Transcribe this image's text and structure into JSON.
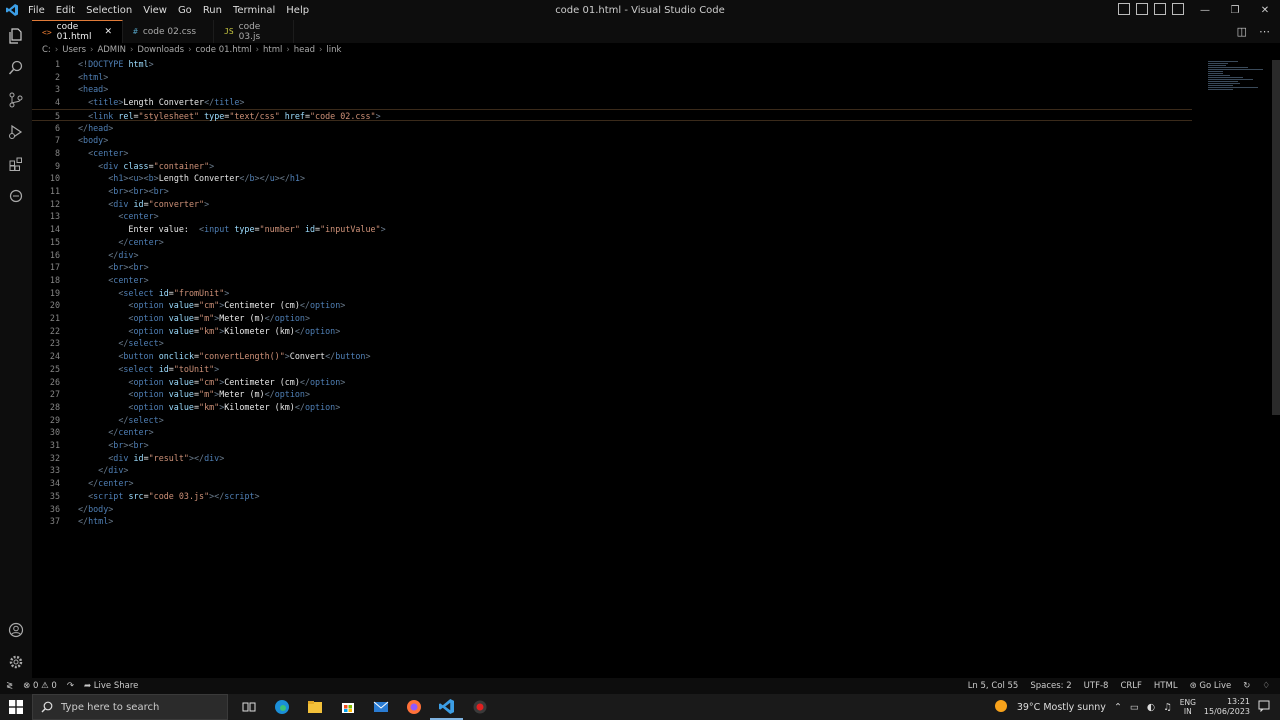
{
  "window": {
    "title": "code 01.html - Visual Studio Code",
    "menu": [
      "File",
      "Edit",
      "Selection",
      "View",
      "Go",
      "Run",
      "Terminal",
      "Help"
    ]
  },
  "tabs": [
    {
      "label": "code 01.html",
      "icon": "<>",
      "icon_color": "#e37933",
      "active": true
    },
    {
      "label": "code 02.css",
      "icon": "#",
      "icon_color": "#519aba",
      "active": false
    },
    {
      "label": "code 03.js",
      "icon": "JS",
      "icon_color": "#cbcb41",
      "active": false
    }
  ],
  "breadcrumb": [
    "C:",
    "Users",
    "ADMIN",
    "Downloads",
    "code 01.html",
    "html",
    "head",
    "link"
  ],
  "code_lines": [
    [
      [
        "t",
        "<!"
      ],
      [
        "tn",
        "DOCTYPE "
      ],
      [
        "an",
        "html"
      ],
      [
        "t",
        ">"
      ]
    ],
    [
      [
        "t",
        "<"
      ],
      [
        "tn",
        "html"
      ],
      [
        "t",
        ">"
      ]
    ],
    [
      [
        "t",
        "<"
      ],
      [
        "tn",
        "head"
      ],
      [
        "t",
        ">"
      ]
    ],
    [
      [
        "t",
        "  <"
      ],
      [
        "tn",
        "title"
      ],
      [
        "t",
        ">"
      ],
      [
        "tx",
        "Length Converter"
      ],
      [
        "t",
        "</"
      ],
      [
        "tn",
        "title"
      ],
      [
        "t",
        ">"
      ]
    ],
    [
      [
        "t",
        "  <"
      ],
      [
        "tn",
        "link "
      ],
      [
        "an",
        "rel"
      ],
      [
        "tx",
        "="
      ],
      [
        "av",
        "\"stylesheet\" "
      ],
      [
        "an",
        "type"
      ],
      [
        "tx",
        "="
      ],
      [
        "av",
        "\"text/css\" "
      ],
      [
        "an",
        "href"
      ],
      [
        "tx",
        "="
      ],
      [
        "av",
        "\"code 02.css\""
      ],
      [
        "t",
        ">"
      ]
    ],
    [
      [
        "t",
        "</"
      ],
      [
        "tn",
        "head"
      ],
      [
        "t",
        ">"
      ]
    ],
    [
      [
        "t",
        "<"
      ],
      [
        "tn",
        "body"
      ],
      [
        "t",
        ">"
      ]
    ],
    [
      [
        "t",
        "  <"
      ],
      [
        "tn",
        "center"
      ],
      [
        "t",
        ">"
      ]
    ],
    [
      [
        "t",
        "    <"
      ],
      [
        "tn",
        "div "
      ],
      [
        "an",
        "class"
      ],
      [
        "tx",
        "="
      ],
      [
        "av",
        "\"container\""
      ],
      [
        "t",
        ">"
      ]
    ],
    [
      [
        "t",
        "      <"
      ],
      [
        "tn",
        "h1"
      ],
      [
        "t",
        "><"
      ],
      [
        "tn",
        "u"
      ],
      [
        "t",
        "><"
      ],
      [
        "tn",
        "b"
      ],
      [
        "t",
        ">"
      ],
      [
        "tx",
        "Length Converter"
      ],
      [
        "t",
        "</"
      ],
      [
        "tn",
        "b"
      ],
      [
        "t",
        "></"
      ],
      [
        "tn",
        "u"
      ],
      [
        "t",
        "></"
      ],
      [
        "tn",
        "h1"
      ],
      [
        "t",
        ">"
      ]
    ],
    [
      [
        "t",
        "      <"
      ],
      [
        "tn",
        "br"
      ],
      [
        "t",
        "><"
      ],
      [
        "tn",
        "br"
      ],
      [
        "t",
        "><"
      ],
      [
        "tn",
        "br"
      ],
      [
        "t",
        ">"
      ]
    ],
    [
      [
        "t",
        "      <"
      ],
      [
        "tn",
        "div "
      ],
      [
        "an",
        "id"
      ],
      [
        "tx",
        "="
      ],
      [
        "av",
        "\"converter\""
      ],
      [
        "t",
        ">"
      ]
    ],
    [
      [
        "t",
        "        <"
      ],
      [
        "tn",
        "center"
      ],
      [
        "t",
        ">"
      ]
    ],
    [
      [
        "tx",
        "          Enter value:  "
      ],
      [
        "t",
        "<"
      ],
      [
        "tn",
        "input "
      ],
      [
        "an",
        "type"
      ],
      [
        "tx",
        "="
      ],
      [
        "av",
        "\"number\" "
      ],
      [
        "an",
        "id"
      ],
      [
        "tx",
        "="
      ],
      [
        "av",
        "\"inputValue\""
      ],
      [
        "t",
        ">"
      ]
    ],
    [
      [
        "t",
        "        </"
      ],
      [
        "tn",
        "center"
      ],
      [
        "t",
        ">"
      ]
    ],
    [
      [
        "t",
        "      </"
      ],
      [
        "tn",
        "div"
      ],
      [
        "t",
        ">"
      ]
    ],
    [
      [
        "t",
        "      <"
      ],
      [
        "tn",
        "br"
      ],
      [
        "t",
        "><"
      ],
      [
        "tn",
        "br"
      ],
      [
        "t",
        ">"
      ]
    ],
    [
      [
        "t",
        "      <"
      ],
      [
        "tn",
        "center"
      ],
      [
        "t",
        ">"
      ]
    ],
    [
      [
        "t",
        "        <"
      ],
      [
        "tn",
        "select "
      ],
      [
        "an",
        "id"
      ],
      [
        "tx",
        "="
      ],
      [
        "av",
        "\"fromUnit\""
      ],
      [
        "t",
        ">"
      ]
    ],
    [
      [
        "t",
        "          <"
      ],
      [
        "tn",
        "option "
      ],
      [
        "an",
        "value"
      ],
      [
        "tx",
        "="
      ],
      [
        "av",
        "\"cm\""
      ],
      [
        "t",
        ">"
      ],
      [
        "tx",
        "Centimeter (cm)"
      ],
      [
        "t",
        "</"
      ],
      [
        "tn",
        "option"
      ],
      [
        "t",
        ">"
      ]
    ],
    [
      [
        "t",
        "          <"
      ],
      [
        "tn",
        "option "
      ],
      [
        "an",
        "value"
      ],
      [
        "tx",
        "="
      ],
      [
        "av",
        "\"m\""
      ],
      [
        "t",
        ">"
      ],
      [
        "tx",
        "Meter (m)"
      ],
      [
        "t",
        "</"
      ],
      [
        "tn",
        "option"
      ],
      [
        "t",
        ">"
      ]
    ],
    [
      [
        "t",
        "          <"
      ],
      [
        "tn",
        "option "
      ],
      [
        "an",
        "value"
      ],
      [
        "tx",
        "="
      ],
      [
        "av",
        "\"km\""
      ],
      [
        "t",
        ">"
      ],
      [
        "tx",
        "Kilometer (km)"
      ],
      [
        "t",
        "</"
      ],
      [
        "tn",
        "option"
      ],
      [
        "t",
        ">"
      ]
    ],
    [
      [
        "t",
        "        </"
      ],
      [
        "tn",
        "select"
      ],
      [
        "t",
        ">"
      ]
    ],
    [
      [
        "t",
        "        <"
      ],
      [
        "tn",
        "button "
      ],
      [
        "an",
        "onclick"
      ],
      [
        "tx",
        "="
      ],
      [
        "av",
        "\"convertLength()\""
      ],
      [
        "t",
        ">"
      ],
      [
        "tx",
        "Convert"
      ],
      [
        "t",
        "</"
      ],
      [
        "tn",
        "button"
      ],
      [
        "t",
        ">"
      ]
    ],
    [
      [
        "t",
        "        <"
      ],
      [
        "tn",
        "select "
      ],
      [
        "an",
        "id"
      ],
      [
        "tx",
        "="
      ],
      [
        "av",
        "\"toUnit\""
      ],
      [
        "t",
        ">"
      ]
    ],
    [
      [
        "t",
        "          <"
      ],
      [
        "tn",
        "option "
      ],
      [
        "an",
        "value"
      ],
      [
        "tx",
        "="
      ],
      [
        "av",
        "\"cm\""
      ],
      [
        "t",
        ">"
      ],
      [
        "tx",
        "Centimeter (cm)"
      ],
      [
        "t",
        "</"
      ],
      [
        "tn",
        "option"
      ],
      [
        "t",
        ">"
      ]
    ],
    [
      [
        "t",
        "          <"
      ],
      [
        "tn",
        "option "
      ],
      [
        "an",
        "value"
      ],
      [
        "tx",
        "="
      ],
      [
        "av",
        "\"m\""
      ],
      [
        "t",
        ">"
      ],
      [
        "tx",
        "Meter (m)"
      ],
      [
        "t",
        "</"
      ],
      [
        "tn",
        "option"
      ],
      [
        "t",
        ">"
      ]
    ],
    [
      [
        "t",
        "          <"
      ],
      [
        "tn",
        "option "
      ],
      [
        "an",
        "value"
      ],
      [
        "tx",
        "="
      ],
      [
        "av",
        "\"km\""
      ],
      [
        "t",
        ">"
      ],
      [
        "tx",
        "Kilometer (km)"
      ],
      [
        "t",
        "</"
      ],
      [
        "tn",
        "option"
      ],
      [
        "t",
        ">"
      ]
    ],
    [
      [
        "t",
        "        </"
      ],
      [
        "tn",
        "select"
      ],
      [
        "t",
        ">"
      ]
    ],
    [
      [
        "t",
        "      </"
      ],
      [
        "tn",
        "center"
      ],
      [
        "t",
        ">"
      ]
    ],
    [
      [
        "t",
        "      <"
      ],
      [
        "tn",
        "br"
      ],
      [
        "t",
        "><"
      ],
      [
        "tn",
        "br"
      ],
      [
        "t",
        ">"
      ]
    ],
    [
      [
        "t",
        "      <"
      ],
      [
        "tn",
        "div "
      ],
      [
        "an",
        "id"
      ],
      [
        "tx",
        "="
      ],
      [
        "av",
        "\"result\""
      ],
      [
        "t",
        "></"
      ],
      [
        "tn",
        "div"
      ],
      [
        "t",
        ">"
      ]
    ],
    [
      [
        "t",
        "    </"
      ],
      [
        "tn",
        "div"
      ],
      [
        "t",
        ">"
      ]
    ],
    [
      [
        "t",
        "  </"
      ],
      [
        "tn",
        "center"
      ],
      [
        "t",
        ">"
      ]
    ],
    [
      [
        "t",
        "  <"
      ],
      [
        "tn",
        "script "
      ],
      [
        "an",
        "src"
      ],
      [
        "tx",
        "="
      ],
      [
        "av",
        "\"code 03.js\""
      ],
      [
        "t",
        "></"
      ],
      [
        "tn",
        "script"
      ],
      [
        "t",
        ">"
      ]
    ],
    [
      [
        "t",
        "</"
      ],
      [
        "tn",
        "body"
      ],
      [
        "t",
        ">"
      ]
    ],
    [
      [
        "t",
        "</"
      ],
      [
        "tn",
        "html"
      ],
      [
        "t",
        ">"
      ]
    ]
  ],
  "current_line": 5,
  "statusbar": {
    "errors": "0",
    "warnings": "0",
    "live_share": "Live Share",
    "position": "Ln 5, Col 55",
    "spaces": "Spaces: 2",
    "encoding": "UTF-8",
    "eol": "CRLF",
    "language": "HTML",
    "go_live": "Go Live"
  },
  "taskbar": {
    "search_placeholder": "Type here to search",
    "weather": "39°C  Mostly sunny",
    "lang_top": "ENG",
    "lang_bottom": "IN",
    "time": "13:21",
    "date": "15/06/2023"
  },
  "colors": {
    "accent": "#e07b39",
    "tag": "#4f7fb5",
    "attr_name": "#9cdcfe",
    "attr_value": "#ce9178"
  }
}
